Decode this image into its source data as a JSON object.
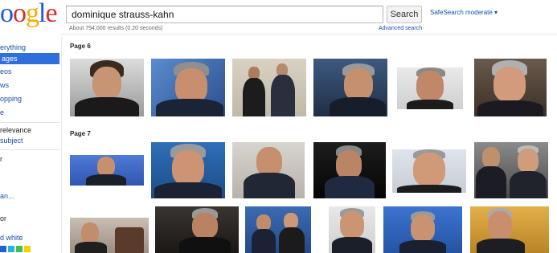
{
  "logo": {
    "part1": "o",
    "part2": "g",
    "part3": "l",
    "part4": "e",
    "prefix": "o"
  },
  "search": {
    "query": "dominique strauss-kahn",
    "button": "Search"
  },
  "header": {
    "safesearch": "SafeSearch moderate ▾",
    "stats": "About 794,000 results (0.20 seconds)",
    "advanced": "Advanced search"
  },
  "sidebar": {
    "items": [
      "erything",
      "ages",
      "eos",
      "ws",
      "opping",
      "e"
    ],
    "sort": [
      "relevance",
      "subject"
    ],
    "misc": [
      "r",
      "an...",
      "or",
      "d white"
    ]
  },
  "results": {
    "page6_label": "Page 6",
    "page7_label": "Page 7"
  },
  "colors": {
    "link": "#1a4fa8",
    "active_nav": "#2f6fdc",
    "swatches": [
      "#1e63d4",
      "#2cb3d9",
      "#3fbf4f",
      "#f5d300"
    ]
  }
}
